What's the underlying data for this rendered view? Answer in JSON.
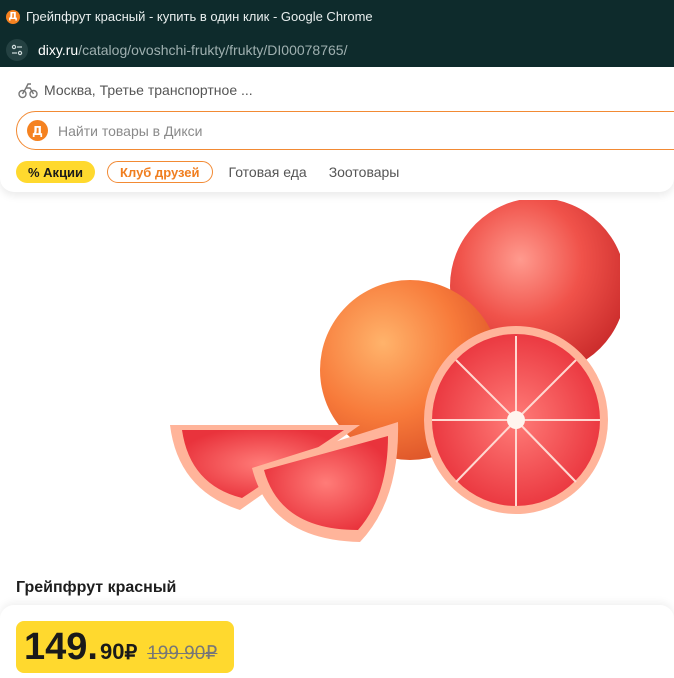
{
  "window": {
    "title": "Грейпфрут красный - купить в один клик - Google Chrome",
    "favicon_letter": "Д",
    "url_domain": "dixy.ru",
    "url_path": "/catalog/ovoshchi-frukty/frukty/DI00078765/"
  },
  "header": {
    "location": "Москва, Третье транспортное ...",
    "search_placeholder": "Найти товары в Дикси",
    "logo_letter": "Д",
    "nav": {
      "promo": "% Акции",
      "club": "Клуб друзей",
      "links": [
        "Готовая еда",
        "Зоотовары"
      ]
    }
  },
  "product": {
    "name": "Грейпфрут красный",
    "price_int": "149.",
    "price_frac": "90",
    "currency": "₽",
    "old_price": "199.90₽"
  },
  "colors": {
    "chrome_bg": "#0e2b2c",
    "accent_orange": "#f28a34",
    "promo_yellow": "#ffd92e"
  }
}
